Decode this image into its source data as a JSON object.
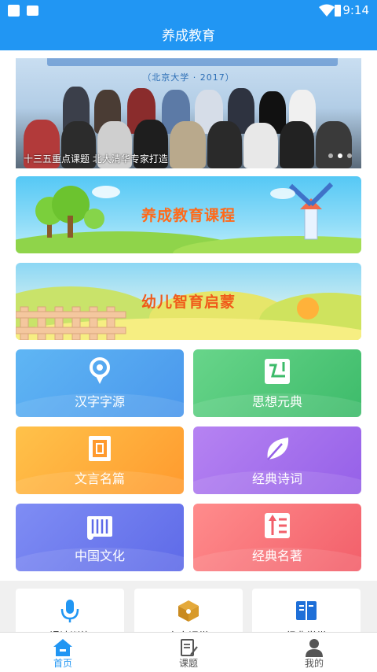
{
  "status_bar": {
    "time": "9:14"
  },
  "app_bar": {
    "title": "养成教育"
  },
  "banner": {
    "subtitle": "（北京大学 · 2017）",
    "caption": "十三五重点课题 北大清华专家打造",
    "slides": 3,
    "active_slide": 2
  },
  "feature_cards": [
    {
      "label": "养成教育课程"
    },
    {
      "label": "幼儿智育启蒙"
    }
  ],
  "categories": [
    {
      "label": "汉字字源",
      "icon": "lightbulb-icon",
      "color": "#5aa8f2"
    },
    {
      "label": "思想元典",
      "icon": "book-scroll-icon",
      "color": "#52c979"
    },
    {
      "label": "文言名篇",
      "icon": "scroll-icon",
      "color": "#ffad3a"
    },
    {
      "label": "经典诗词",
      "icon": "leaf-icon",
      "color": "#a672ee"
    },
    {
      "label": "中国文化",
      "icon": "bamboo-scroll-icon",
      "color": "#6f7cef"
    },
    {
      "label": "经典名著",
      "icon": "book-icon",
      "color": "#f57379"
    }
  ],
  "quick_links": [
    {
      "label": "诵读训练",
      "icon": "microphone-icon"
    },
    {
      "label": "专家课堂",
      "icon": "box-icon"
    },
    {
      "label": "经典学堂",
      "icon": "open-book-icon"
    }
  ],
  "bottom_nav": [
    {
      "label": "首页",
      "icon": "home-icon",
      "active": true
    },
    {
      "label": "课题",
      "icon": "notepad-icon",
      "active": false
    },
    {
      "label": "我的",
      "icon": "user-icon",
      "active": false
    }
  ]
}
